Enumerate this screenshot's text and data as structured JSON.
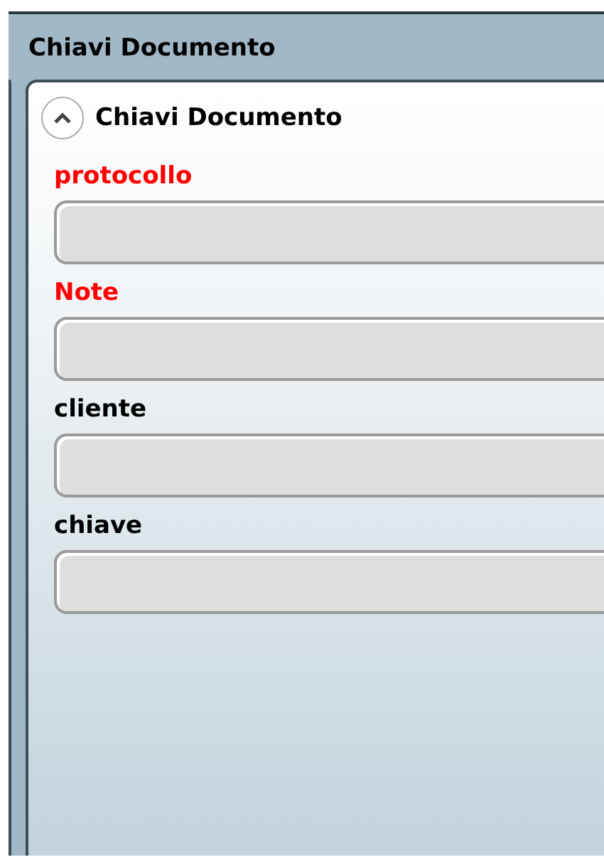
{
  "panel": {
    "title": "Chiavi Documento"
  },
  "group": {
    "title": "Chiavi Documento",
    "expanded": true
  },
  "fields": [
    {
      "label": "protocollo",
      "required": true
    },
    {
      "label": "Note",
      "required": true
    },
    {
      "label": "cliente",
      "required": false
    },
    {
      "label": "chiave",
      "required": false
    }
  ]
}
